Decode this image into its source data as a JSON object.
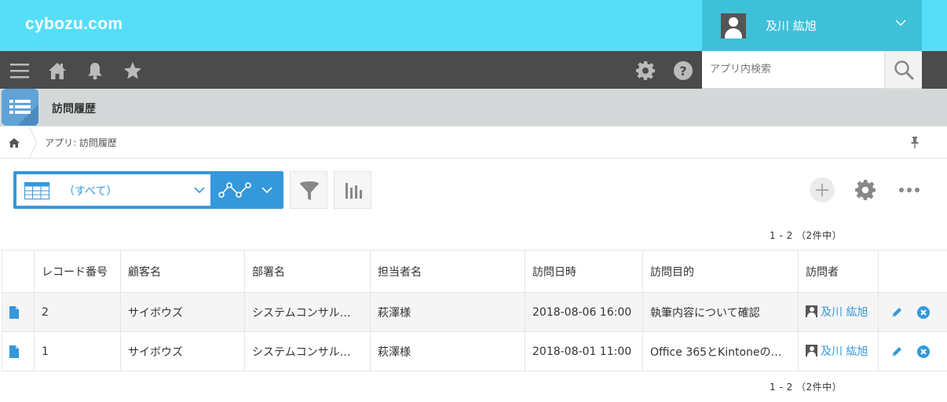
{
  "header": {
    "logo": "cybozu.com",
    "user_name": "及川 紘旭"
  },
  "toolbar": {
    "search_placeholder": "アプリ内検索"
  },
  "app": {
    "title": "訪問履歴"
  },
  "breadcrumb": {
    "text": "アプリ: 訪問履歴"
  },
  "view": {
    "selected": "（すべて）"
  },
  "pager": {
    "top": "1 - 2 （2件中）",
    "bottom": "1 - 2 （2件中）"
  },
  "table": {
    "columns": [
      "レコード番号",
      "顧客名",
      "部署名",
      "担当者名",
      "訪問日時",
      "訪問目的",
      "訪問者"
    ],
    "rows": [
      {
        "record_no": "2",
        "customer": "サイボウズ",
        "department": "システムコンサル…",
        "contact": "萩澤様",
        "datetime": "2018-08-06 16:00",
        "purpose": "執筆内容について確認",
        "visitor": "及川 紘旭"
      },
      {
        "record_no": "1",
        "customer": "サイボウズ",
        "department": "システムコンサル…",
        "contact": "萩澤様",
        "datetime": "2018-08-01 11:00",
        "purpose": "Office 365とKintoneの…",
        "visitor": "及川 紘旭"
      }
    ]
  },
  "colors": {
    "header_bg": "#56def8",
    "toolbar_bg": "#4b4b4b",
    "accent": "#3498db",
    "appbar_bg": "#d4d8d9"
  }
}
